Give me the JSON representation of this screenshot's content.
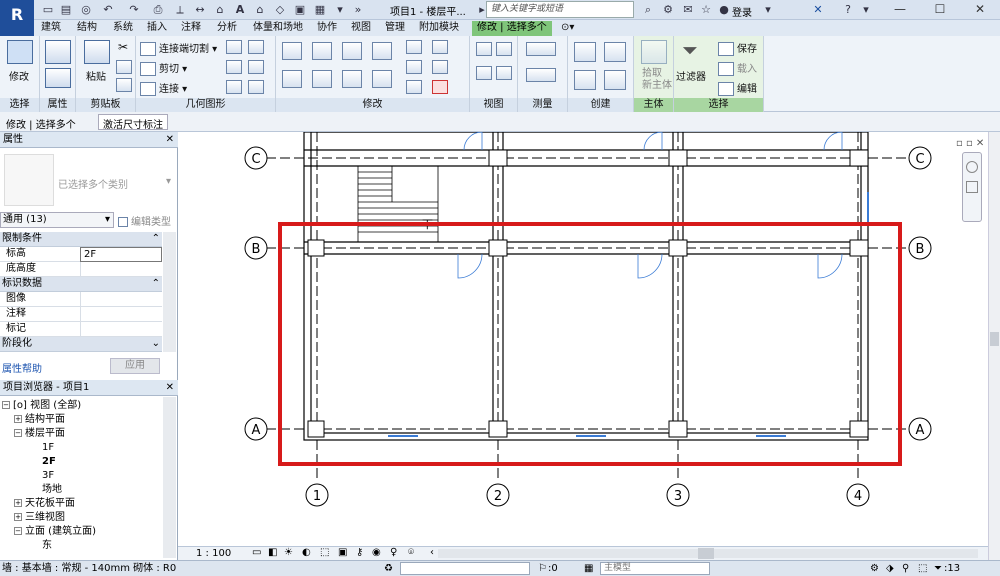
{
  "app": {
    "document_title": "项目1 - 楼层平...",
    "search_placeholder": "键入关键字或短语",
    "login_label": "登录"
  },
  "tabs": [
    "建筑",
    "结构",
    "系统",
    "插入",
    "注释",
    "分析",
    "体量和场地",
    "协作",
    "视图",
    "管理",
    "附加模块",
    "修改 | 选择多个"
  ],
  "ribbon": {
    "panels": {
      "select": "选择",
      "properties": "属性",
      "clipboard": "剪贴板",
      "geometry": "几何图形",
      "modify": "修改",
      "view": "视图",
      "measure": "测量",
      "create": "创建",
      "host": "主体",
      "selection": "选择"
    },
    "buttons": {
      "modify": "修改",
      "paste": "粘贴",
      "cut_join": "连接端切割",
      "cut": "剪切",
      "join": "连接",
      "pick_new_host": "拾取\n新主体",
      "filter": "过滤器",
      "save": "保存",
      "load": "载入",
      "edit": "编辑"
    }
  },
  "option_bar": {
    "context": "修改 | 选择多个",
    "activate_dims": "激活尺寸标注"
  },
  "properties": {
    "title": "属性",
    "type_placeholder": "已选择多个类别",
    "filter_value": "通用 (13)",
    "edit_type": "编辑类型",
    "groups": {
      "constraints": "限制条件",
      "identity": "标识数据",
      "phasing": "阶段化"
    },
    "rows": {
      "level_label": "标高",
      "level_value": "2F",
      "base_height_label": "底高度",
      "image_label": "图像",
      "comments_label": "注释",
      "mark_label": "标记"
    },
    "help": "属性帮助",
    "apply": "应用"
  },
  "browser": {
    "title": "项目浏览器 - 项目1",
    "nodes": {
      "views": "视图 (全部)",
      "structural_plans": "结构平面",
      "floor_plans": "楼层平面",
      "f1": "1F",
      "f2": "2F",
      "f3": "3F",
      "site": "场地",
      "ceiling_plans": "天花板平面",
      "3d_views": "三维视图",
      "elevations": "立面 (建筑立面)",
      "east": "东"
    }
  },
  "canvas": {
    "grid_rows": [
      "C",
      "B",
      "A"
    ],
    "grid_cols": [
      "1",
      "2",
      "3",
      "4"
    ],
    "stair_label": "下"
  },
  "view_control": {
    "scale": "1 : 100"
  },
  "status": {
    "text": "墙 : 基本墙 : 常规 - 140mm 砌体 : R0",
    "count_zero": ":0",
    "model": "主模型",
    "filter_count": ":13"
  },
  "colors": {
    "context_tab": "#7fc57a",
    "selection_box": "#d71a1a",
    "ribbon_bg": "#eef3f9"
  }
}
